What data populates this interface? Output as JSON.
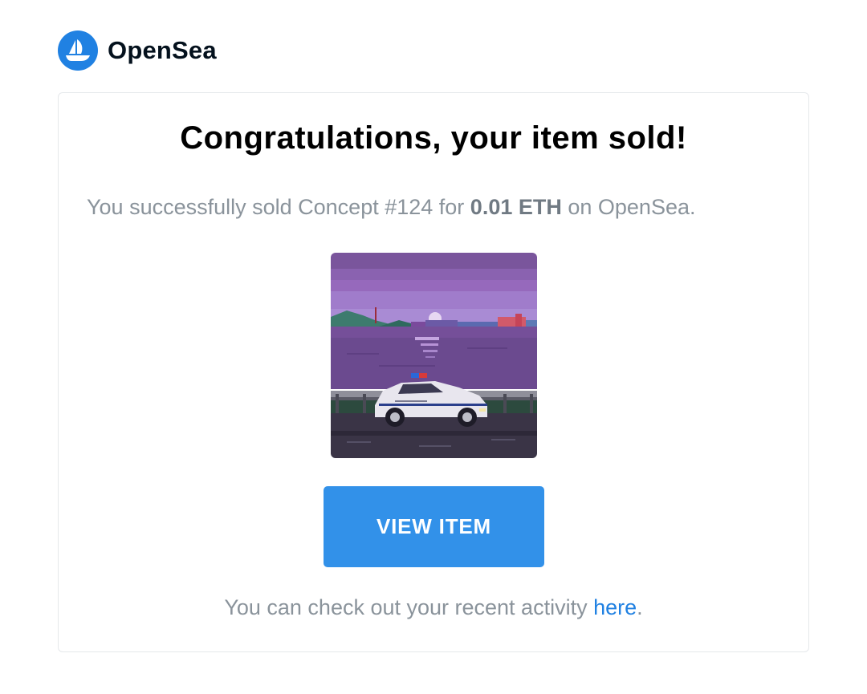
{
  "brand": {
    "name": "OpenSea",
    "logo_icon": "opensea-sailboat-icon",
    "accent_color": "#2081e2"
  },
  "card": {
    "title": "Congratulations, your item sold!",
    "message": {
      "prefix": "You successfully sold Concept #124 for ",
      "price": "0.01 ETH",
      "suffix": " on OpenSea."
    },
    "item_image": {
      "icon": "pixel-art-police-car-image"
    },
    "button": {
      "label": "VIEW ITEM",
      "color": "#3291e9"
    },
    "footer": {
      "prefix": "You can check out your recent activity ",
      "link_label": "here",
      "suffix": "."
    }
  }
}
